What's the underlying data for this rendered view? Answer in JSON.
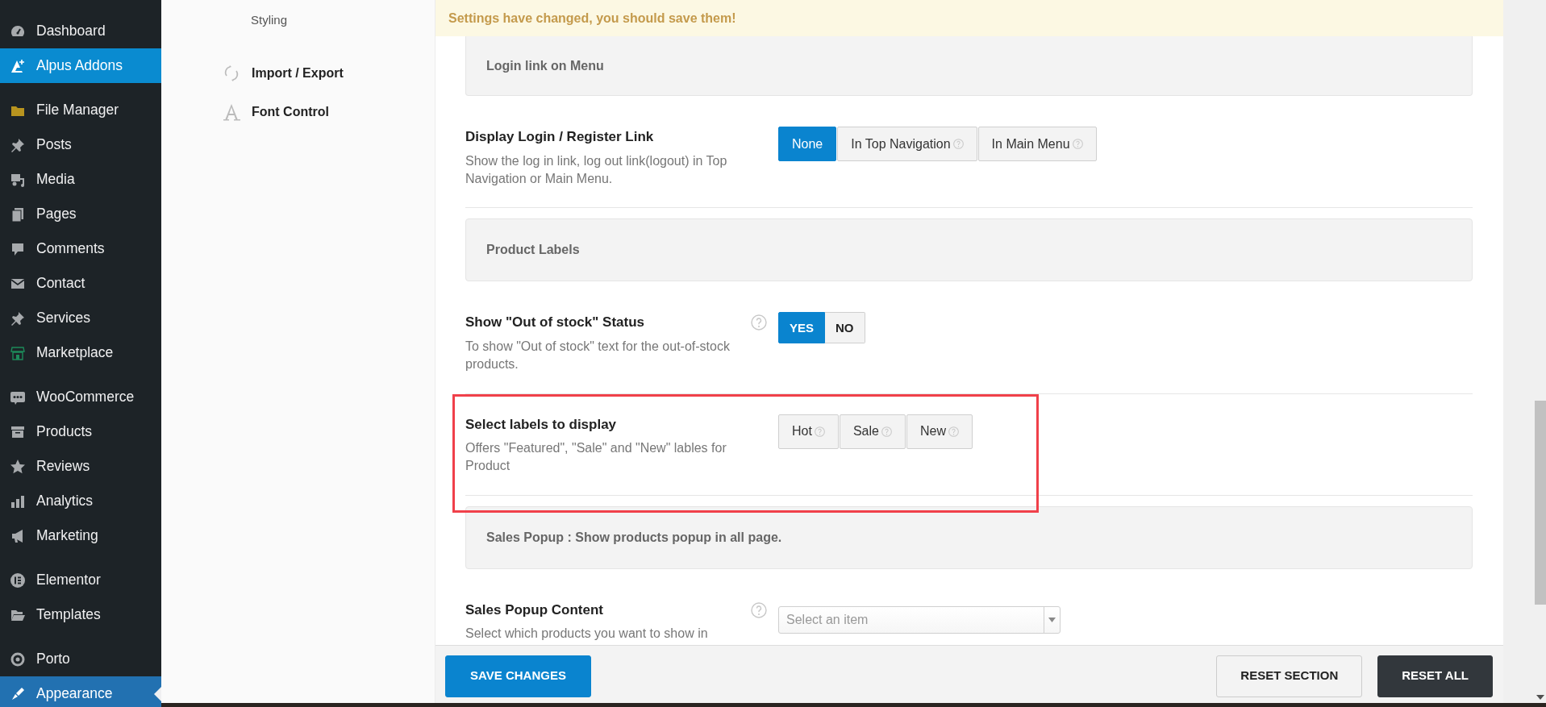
{
  "admin_menu": {
    "groups": [
      [
        {
          "label": "Dashboard",
          "selected": false,
          "hovered": false
        },
        {
          "label": "Alpus Addons",
          "selected": false,
          "hovered": true
        }
      ],
      [
        {
          "label": "File Manager",
          "selected": false,
          "hovered": false
        },
        {
          "label": "Posts",
          "selected": false,
          "hovered": false
        },
        {
          "label": "Media",
          "selected": false,
          "hovered": false
        },
        {
          "label": "Pages",
          "selected": false,
          "hovered": false
        },
        {
          "label": "Comments",
          "selected": false,
          "hovered": false
        },
        {
          "label": "Contact",
          "selected": false,
          "hovered": false
        },
        {
          "label": "Services",
          "selected": false,
          "hovered": false
        },
        {
          "label": "Marketplace",
          "selected": false,
          "hovered": false
        }
      ],
      [
        {
          "label": "WooCommerce",
          "selected": false,
          "hovered": false
        },
        {
          "label": "Products",
          "selected": false,
          "hovered": false
        },
        {
          "label": "Reviews",
          "selected": false,
          "hovered": false
        },
        {
          "label": "Analytics",
          "selected": false,
          "hovered": false
        },
        {
          "label": "Marketing",
          "selected": false,
          "hovered": false
        }
      ],
      [
        {
          "label": "Elementor",
          "selected": false,
          "hovered": false
        },
        {
          "label": "Templates",
          "selected": false,
          "hovered": false
        }
      ],
      [
        {
          "label": "Porto",
          "selected": false,
          "hovered": false
        },
        {
          "label": "Appearance",
          "selected": true,
          "hovered": false
        }
      ]
    ]
  },
  "options_nav": [
    {
      "label": "Styling",
      "kind": "subitem"
    },
    {
      "label": "Import / Export",
      "kind": "section"
    },
    {
      "label": "Font Control",
      "kind": "section"
    }
  ],
  "notice": "Settings have changed, you should save them!",
  "sections": [
    {
      "kind": "header",
      "title": "Login link on Menu"
    },
    {
      "kind": "field",
      "title": "Display Login / Register Link",
      "description": "Show the log in link, log out link(logout) in Top Navigation or Main Menu.",
      "help": false,
      "highlighted": false,
      "control": {
        "kind": "button_group",
        "options": [
          {
            "label": "None",
            "selected": true,
            "help": false
          },
          {
            "label": "In Top Navigation",
            "selected": false,
            "help": true
          },
          {
            "label": "In Main Menu",
            "selected": false,
            "help": true
          }
        ]
      }
    },
    {
      "kind": "header",
      "title": "Product Labels"
    },
    {
      "kind": "field",
      "title": "Show \"Out of stock\" Status",
      "description": "To show \"Out of stock\" text for the out-of-stock products.",
      "help": true,
      "highlighted": false,
      "control": {
        "kind": "toggle",
        "options": [
          {
            "label": "YES",
            "selected": true
          },
          {
            "label": "NO",
            "selected": false
          }
        ]
      }
    },
    {
      "kind": "field",
      "title": "Select labels to display",
      "description": "Offers \"Featured\", \"Sale\" and \"New\" lables for Product",
      "help": false,
      "highlighted": true,
      "control": {
        "kind": "button_group",
        "options": [
          {
            "label": "Hot",
            "selected": false,
            "help": true
          },
          {
            "label": "Sale",
            "selected": false,
            "help": true
          },
          {
            "label": "New",
            "selected": false,
            "help": true
          }
        ]
      }
    },
    {
      "kind": "header",
      "title": "Sales Popup : Show products popup in all page."
    },
    {
      "kind": "field",
      "title": "Sales Popup Content",
      "description": "Select which products you want to show in",
      "help": true,
      "highlighted": false,
      "control": {
        "kind": "select",
        "placeholder": "Select an item"
      }
    }
  ],
  "footer": {
    "buttons": [
      {
        "label": "SAVE CHANGES",
        "kind": "primary"
      },
      {
        "label": "RESET SECTION",
        "kind": "secondary"
      },
      {
        "label": "RESET ALL",
        "kind": "dark"
      }
    ]
  }
}
